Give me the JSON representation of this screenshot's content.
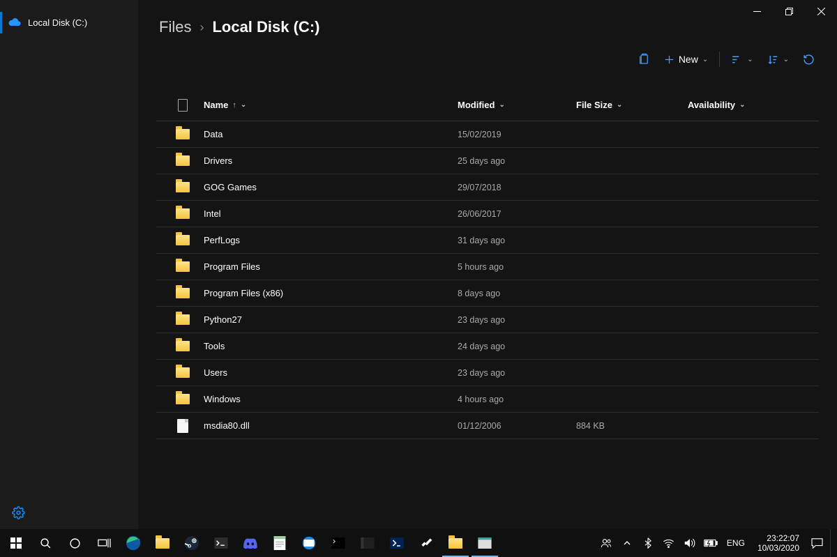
{
  "window": {
    "minimize_label": "Minimize",
    "maximize_label": "Maximize",
    "close_label": "Close"
  },
  "sidebar": {
    "items": [
      {
        "label": "Local Disk (C:)"
      }
    ],
    "settings_label": "Settings"
  },
  "breadcrumb": {
    "root": "Files",
    "current": "Local Disk (C:)"
  },
  "toolbar": {
    "new_label": "New"
  },
  "columns": {
    "type": "",
    "name": "Name",
    "modified": "Modified",
    "size": "File Size",
    "availability": "Availability"
  },
  "rows": [
    {
      "type": "folder",
      "name": "Data",
      "modified": "15/02/2019",
      "size": "",
      "availability": ""
    },
    {
      "type": "folder",
      "name": "Drivers",
      "modified": "25 days ago",
      "size": "",
      "availability": ""
    },
    {
      "type": "folder",
      "name": "GOG Games",
      "modified": "29/07/2018",
      "size": "",
      "availability": ""
    },
    {
      "type": "folder",
      "name": "Intel",
      "modified": "26/06/2017",
      "size": "",
      "availability": ""
    },
    {
      "type": "folder",
      "name": "PerfLogs",
      "modified": "31 days ago",
      "size": "",
      "availability": ""
    },
    {
      "type": "folder",
      "name": "Program Files",
      "modified": "5 hours ago",
      "size": "",
      "availability": ""
    },
    {
      "type": "folder",
      "name": "Program Files (x86)",
      "modified": "8 days ago",
      "size": "",
      "availability": ""
    },
    {
      "type": "folder",
      "name": "Python27",
      "modified": "23 days ago",
      "size": "",
      "availability": ""
    },
    {
      "type": "folder",
      "name": "Tools",
      "modified": "24 days ago",
      "size": "",
      "availability": ""
    },
    {
      "type": "folder",
      "name": "Users",
      "modified": "23 days ago",
      "size": "",
      "availability": ""
    },
    {
      "type": "folder",
      "name": "Windows",
      "modified": "4 hours ago",
      "size": "",
      "availability": ""
    },
    {
      "type": "file",
      "name": "msdia80.dll",
      "modified": "01/12/2006",
      "size": "884 KB",
      "availability": ""
    }
  ],
  "taskbar": {
    "language": "ENG",
    "time": "23:22:07",
    "date": "10/03/2020"
  }
}
